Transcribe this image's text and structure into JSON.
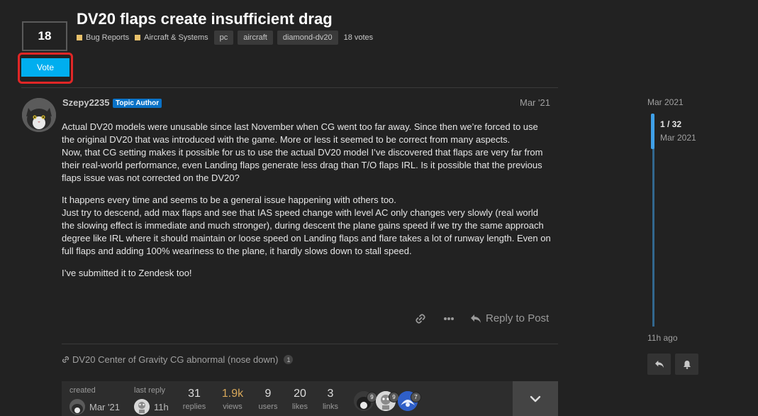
{
  "topic": {
    "title": "DV20 flaps create insufficient drag",
    "vote_count": "18",
    "vote_label": "Vote",
    "categories": [
      {
        "label": "Bug Reports",
        "color": "#e9c16b"
      },
      {
        "label": "Aircraft & Systems",
        "color": "#e9c16b"
      }
    ],
    "tags": [
      "pc",
      "aircraft",
      "diamond-dv20"
    ],
    "votes_text": "18 votes"
  },
  "post": {
    "username": "Szepy2235",
    "badge": "Topic Author",
    "date": "Mar '21",
    "paragraphs": [
      "Actual DV20 models were unusable since last November when CG went too far away. Since then we’re forced to use the original DV20 that was introduced with the game. More or less it seemed to be correct from many aspects.\nNow, that CG setting makes it possible for us to use the actual DV20 model I’ve discovered that flaps are very far from their real-world performance, even Landing flaps generate less drag than T/O flaps IRL. Is it possible that the previous flaps issue was not corrected on the DV20?",
      "It happens every time and seems to be a general issue happening with others too.\nJust try to descend, add max flaps and see that IAS speed change with level AC only changes very slowly (real world the slowing effect is immediate and much stronger), during descent the plane gains speed if we try the same approach degree like IRL where it should maintain or loose speed on Landing flaps and flare takes a lot of runway length. Even on full flaps and adding 100% weariness to the plane, it hardly slows down to stall speed.",
      "I’ve submitted it to Zendesk too!"
    ],
    "reply_label": "Reply to Post",
    "linked_topic": "DV20 Center of Gravity CG abnormal (nose down)",
    "linked_count": "1"
  },
  "stats": {
    "created_label": "created",
    "created_date": "Mar '21",
    "last_reply_label": "last reply",
    "last_reply_date": "11h",
    "replies": "31",
    "replies_label": "replies",
    "views": "1.9k",
    "views_label": "views",
    "views_color": "#d8a85a",
    "users": "9",
    "users_label": "users",
    "likes": "20",
    "likes_label": "likes",
    "links": "3",
    "links_label": "links",
    "participants": [
      {
        "count": "9"
      },
      {
        "count": "9"
      },
      {
        "count": "7"
      }
    ]
  },
  "timeline": {
    "start_date": "Mar 2021",
    "position": "1 / 32",
    "position_date": "Mar 2021",
    "end_label": "11h ago"
  },
  "colors": {
    "accent": "#00aeef",
    "background": "#222222",
    "highlight": "#e12626",
    "badge": "#0a72c7"
  }
}
